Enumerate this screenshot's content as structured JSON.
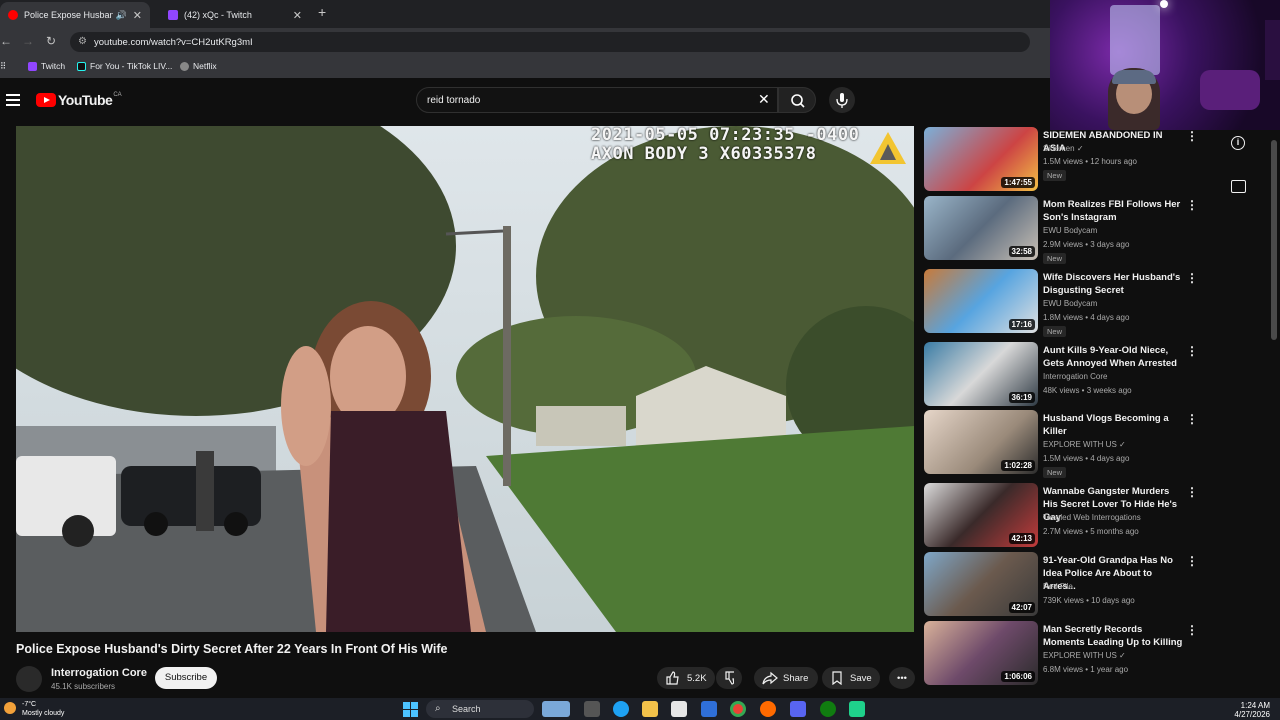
{
  "browser": {
    "tabs": [
      {
        "title": "Police Expose Husband's D",
        "active": true,
        "color": "#ff0000"
      },
      {
        "title": "(42) xQc - Twitch",
        "active": false,
        "color": "#9146ff"
      }
    ],
    "url": "youtube.com/watch?v=CH2utKRg3mI",
    "bookmarks": [
      "Twitch",
      "For You - TikTok LIV...",
      "Netflix"
    ]
  },
  "youtube": {
    "logo_text": "YouTube",
    "country": "CA",
    "search_query": "reid tornado"
  },
  "video": {
    "osd_line1": "2021-05-05 07:23:35 -0400",
    "osd_line2": "AXON BODY 3 X60335378",
    "title": "Police Expose Husband's Dirty Secret After 22 Years In Front Of His Wife",
    "channel": "Interrogation Core",
    "subscribers": "45.1K subscribers",
    "subscribe_label": "Subscribe",
    "likes": "5.2K",
    "share_label": "Share",
    "save_label": "Save"
  },
  "recommendations": [
    {
      "title": "SIDEMEN ABANDONED IN ASIA",
      "channel": "Sidemen",
      "meta": "1.5M views • 12 hours ago",
      "new": "New",
      "duration": "1:47:55"
    },
    {
      "title": "Mom Realizes FBI Follows Her Son's Instagram",
      "channel": "EWU Bodycam",
      "meta": "2.9M views • 3 days ago",
      "new": "New",
      "duration": "32:58"
    },
    {
      "title": "Wife Discovers Her Husband's Disgusting Secret",
      "channel": "EWU Bodycam",
      "meta": "1.8M views • 4 days ago",
      "new": "New",
      "duration": "17:16"
    },
    {
      "title": "Aunt Kills 9-Year-Old Niece, Gets Annoyed When Arrested",
      "channel": "Interrogation Core",
      "meta": "48K views • 3 weeks ago",
      "new": "",
      "duration": "36:19"
    },
    {
      "title": "Husband Vlogs Becoming a Killer",
      "channel": "EXPLORE WITH US",
      "meta": "1.5M views • 4 days ago",
      "new": "New",
      "duration": "1:02:28"
    },
    {
      "title": "Wannabe Gangster Murders His Secret Lover To Hide He's Gay",
      "channel": "Tangled Web Interrogations",
      "meta": "2.7M views • 5 months ago",
      "new": "",
      "duration": "42:13"
    },
    {
      "title": "91-Year-Old Grandpa Has No Idea Police Are About to Arres...",
      "channel": "Red File",
      "meta": "739K views • 10 days ago",
      "new": "",
      "duration": "42:07"
    },
    {
      "title": "Man Secretly Records Moments Leading Up to Killing",
      "channel": "EXPLORE WITH US",
      "meta": "6.8M views • 1 year ago",
      "new": "",
      "duration": "1:06:06"
    }
  ],
  "taskbar": {
    "temp": "-7°C",
    "weather": "Mostly cloudy",
    "search": "Search",
    "time": "1:24 AM",
    "date": "4/27/2026"
  }
}
